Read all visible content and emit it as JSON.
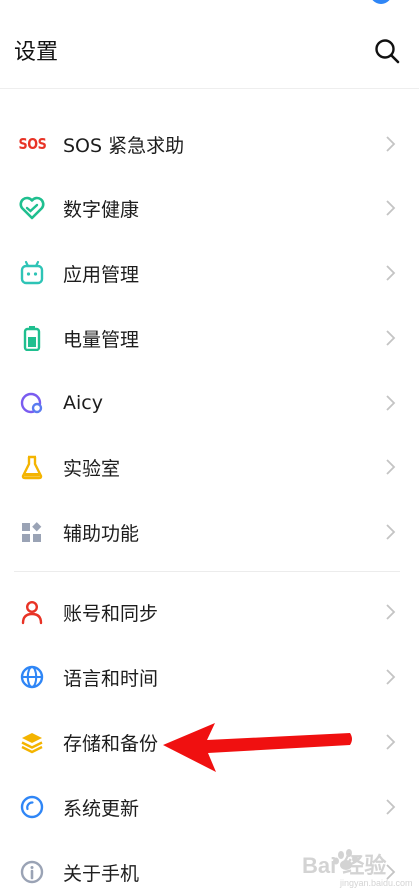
{
  "header": {
    "title": "设置"
  },
  "items": [
    {
      "label": "SOS 紧急求助",
      "icon": "sos-icon"
    },
    {
      "label": "数字健康",
      "icon": "digital-health-icon"
    },
    {
      "label": "应用管理",
      "icon": "app-manage-icon"
    },
    {
      "label": "电量管理",
      "icon": "battery-icon"
    },
    {
      "label": "Aicy",
      "icon": "aicy-icon"
    },
    {
      "label": "实验室",
      "icon": "lab-flask-icon"
    },
    {
      "label": "辅助功能",
      "icon": "accessibility-icon"
    },
    {
      "label": "账号和同步",
      "icon": "account-icon"
    },
    {
      "label": "语言和时间",
      "icon": "globe-icon"
    },
    {
      "label": "存储和备份",
      "icon": "storage-layers-icon"
    },
    {
      "label": "系统更新",
      "icon": "system-update-icon"
    },
    {
      "label": "关于手机",
      "icon": "info-icon"
    }
  ],
  "icons": {
    "sos_text": "SOS"
  },
  "watermark": {
    "text": "Bai 经验",
    "subtext": "jingyan.baidu.com"
  },
  "colors": {
    "red": "#e83326",
    "green": "#1fbf8f",
    "teal": "#2ec4b6",
    "purple": "#7a5cf0",
    "amber": "#f4b400",
    "blue": "#2f86f6",
    "gray": "#9aa3b5"
  }
}
